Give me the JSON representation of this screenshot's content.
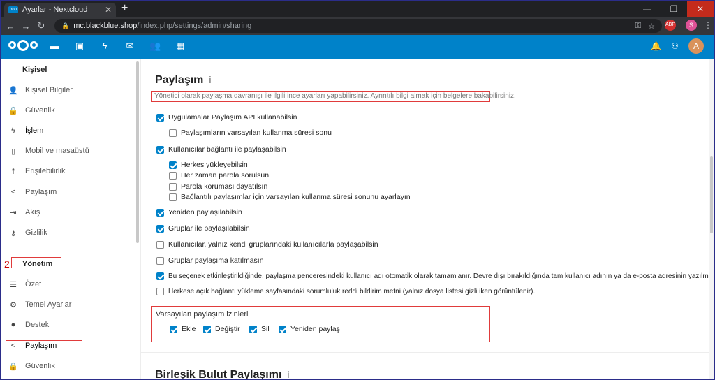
{
  "browser": {
    "tab_title": "Ayarlar - Nextcloud",
    "tab_close": "✕",
    "new_tab": "+",
    "url_host": "mc.blackblue.shop",
    "url_path": "/index.php/settings/admin/sharing",
    "profile_initial": "S",
    "abp_label": "ABP"
  },
  "header": {
    "avatar_initial": "A"
  },
  "sidebar": {
    "personal_heading": "Kişisel",
    "personal_items": [
      {
        "label": "Kişisel Bilgiler",
        "icon": "user-icon"
      },
      {
        "label": "Güvenlik",
        "icon": "lock-icon"
      },
      {
        "label": "İşlem",
        "icon": "bolt-icon"
      },
      {
        "label": "Mobil ve masaüstü",
        "icon": "phone-icon"
      },
      {
        "label": "Erişilebilirlik",
        "icon": "accessibility-icon"
      },
      {
        "label": "Paylaşım",
        "icon": "share-icon"
      },
      {
        "label": "Akış",
        "icon": "flow-icon"
      },
      {
        "label": "Gizlilik",
        "icon": "key-icon"
      }
    ],
    "annotation_number": "2",
    "admin_heading": "Yönetim",
    "admin_items": [
      {
        "label": "Özet",
        "icon": "list-icon"
      },
      {
        "label": "Temel Ayarlar",
        "icon": "gear-icon"
      },
      {
        "label": "Destek",
        "icon": "chat-icon"
      },
      {
        "label": "Paylaşım",
        "icon": "share-icon"
      },
      {
        "label": "Güvenlik",
        "icon": "lock-icon"
      }
    ]
  },
  "main": {
    "title": "Paylaşım",
    "info_icon": "i",
    "description": "Yönetici olarak paylaşma davranışı ile ilgili ince ayarları yapabilirsiniz. Ayrıntılı bilgi almak için belgelere bakabilirsiniz.",
    "options": [
      {
        "label": "Uygulamalar Paylaşım API kullanabilsin",
        "checked": true
      },
      {
        "label": "Paylaşımların varsayılan kullanma süresi sonu",
        "checked": false
      },
      {
        "label": "Kullanıcılar bağlantı ile paylaşabilsin",
        "checked": true
      },
      {
        "label": "Herkes yükleyebilsin",
        "checked": true
      },
      {
        "label": "Her zaman parola sorulsun",
        "checked": false
      },
      {
        "label": "Parola koruması dayatılsın",
        "checked": false
      },
      {
        "label": "Bağlantılı paylaşımlar için varsayılan kullanma süresi sonunu ayarlayın",
        "checked": false
      },
      {
        "label": "Yeniden paylaşılabilsin",
        "checked": true
      },
      {
        "label": "Gruplar ile paylaşılabilsin",
        "checked": true
      },
      {
        "label": "Kullanıcılar, yalnız kendi gruplarındaki kullanıcılarla paylaşabilsin",
        "checked": false
      },
      {
        "label": "Gruplar paylaşıma katılmasın",
        "checked": false
      },
      {
        "label": "Bu seçenek etkinleştirildiğinde, paylaşma penceresindeki kullanıcı adı otomatik olarak tamamlanır. Devre dışı bırakıldığında tam kullanıcı adının ya da e-posta adresinin yazılması gerekir.",
        "checked": true
      },
      {
        "label": "Herkese açık bağlantı yükleme sayfasındaki sorumluluk reddi bildirim metni (yalnız dosya listesi gizli iken görüntülenir).",
        "checked": false
      }
    ],
    "permissions_title": "Varsayılan paylaşım izinleri",
    "permissions": [
      {
        "label": "Ekle",
        "checked": true
      },
      {
        "label": "Değiştir",
        "checked": true
      },
      {
        "label": "Sil",
        "checked": true
      },
      {
        "label": "Yeniden paylaş",
        "checked": true
      }
    ],
    "federated_title": "Birleşik Bulut Paylaşımı",
    "federated_info": "i"
  },
  "colors": {
    "brand": "#0082c9",
    "annotation_red": "#e03b3b"
  }
}
